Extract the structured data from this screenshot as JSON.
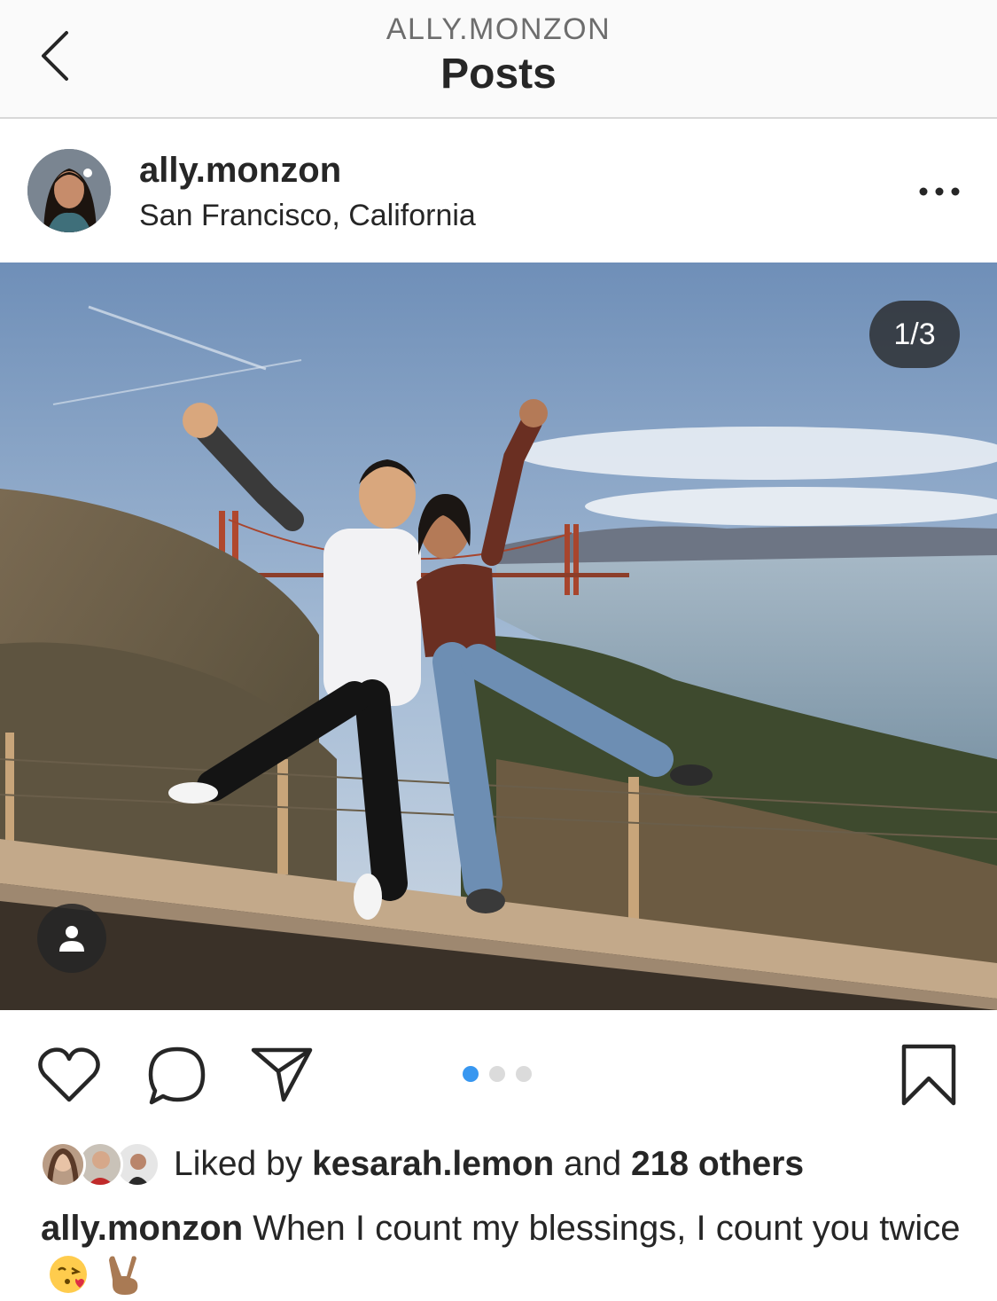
{
  "nav": {
    "username": "ALLY.MONZON",
    "title": "Posts"
  },
  "post": {
    "username": "ally.monzon",
    "location": "San Francisco, California",
    "carousel_counter": "1/3",
    "carousel": {
      "current": 1,
      "total": 3
    }
  },
  "actions": {
    "like_icon": "heart-icon",
    "comment_icon": "comment-icon",
    "share_icon": "send-icon",
    "save_icon": "bookmark-icon"
  },
  "likes": {
    "prefix": "Liked by",
    "first_user": "kesarah.lemon",
    "connector": "and",
    "others": "218 others"
  },
  "caption": {
    "username": "ally.monzon",
    "text": "When I count my blessings, I count you twice",
    "emojis": [
      "kissing-face-emoji",
      "victory-hand-emoji"
    ]
  },
  "colors": {
    "accent": "#3897f0",
    "text": "#262626",
    "secondary_text": "#6d6d6d",
    "nav_bg": "#fafafa"
  }
}
